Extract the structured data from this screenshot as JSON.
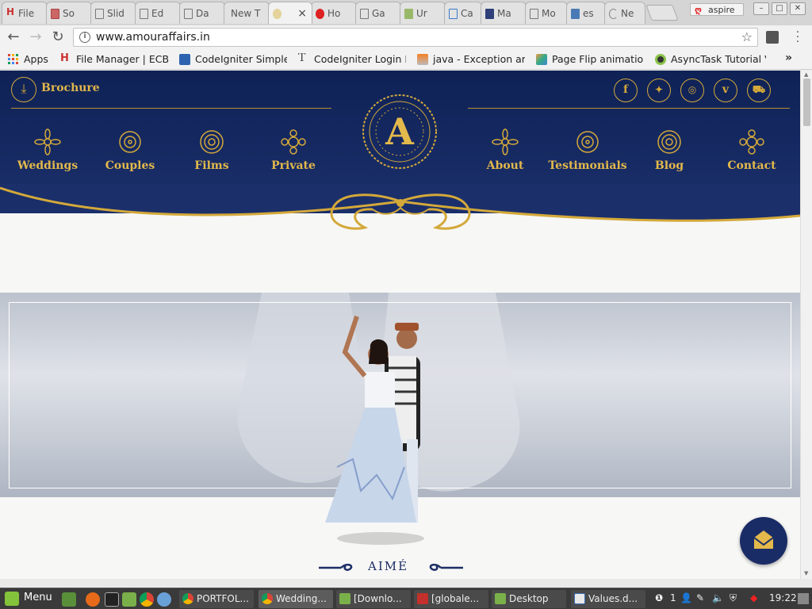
{
  "browser": {
    "tabs": [
      {
        "label": "File"
      },
      {
        "label": "So"
      },
      {
        "label": "Slid"
      },
      {
        "label": "Ed"
      },
      {
        "label": "Da"
      },
      {
        "label": "New T"
      },
      {
        "label": ""
      },
      {
        "label": "Ho"
      },
      {
        "label": "Ga"
      },
      {
        "label": "Ur"
      },
      {
        "label": "Ca"
      },
      {
        "label": "Ma"
      },
      {
        "label": "Mo"
      },
      {
        "label": "es"
      },
      {
        "label": "Ne"
      }
    ],
    "active_tab_close": "×",
    "profile_name": "aspire",
    "url": "www.amouraffairs.in",
    "bookmarks": [
      {
        "label": "Apps"
      },
      {
        "label": "File Manager | ECB"
      },
      {
        "label": "CodeIgniter Simple"
      },
      {
        "label": "CodeIgniter Login Fo"
      },
      {
        "label": "java - Exception aros"
      },
      {
        "label": "Page Flip animation"
      },
      {
        "label": "AsyncTask Tutorial V"
      }
    ],
    "bookmarks_more": "»"
  },
  "site": {
    "brochure_label": "Brochure",
    "social": [
      "f",
      "t",
      "ig",
      "v",
      "cart"
    ],
    "nav_left": [
      "Weddings",
      "Couples",
      "Films",
      "Private"
    ],
    "nav_right": [
      "About",
      "Testimonials",
      "Blog",
      "Contact"
    ],
    "logo_letter": "A",
    "hero_caption": "AIMÉ"
  },
  "taskbar": {
    "menu_label": "Menu",
    "tasks": [
      {
        "label": "PORTFOL..."
      },
      {
        "label": "Wedding..."
      },
      {
        "label": "[Downlo..."
      },
      {
        "label": "[globale..."
      },
      {
        "label": "Desktop"
      },
      {
        "label": "Values.d..."
      }
    ],
    "tray_count": "1",
    "clock": "19:22"
  },
  "colors": {
    "navy": "#1b2f6b",
    "gold": "#d4a93a"
  }
}
